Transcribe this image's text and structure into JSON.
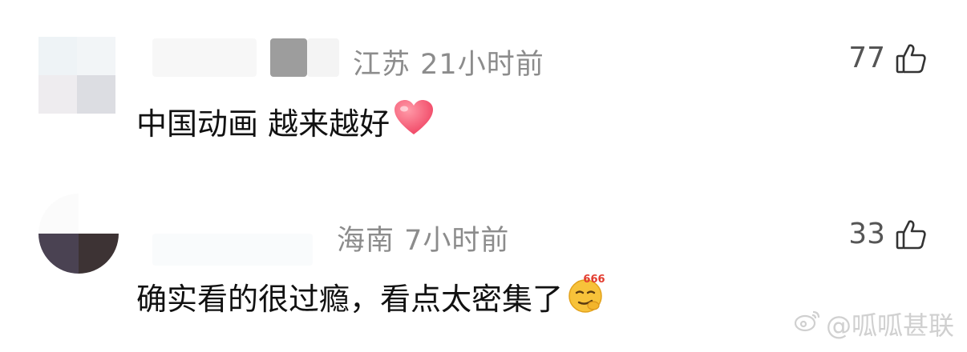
{
  "comments": [
    {
      "location": "江苏",
      "time": "21小时前",
      "text": "中国动画 越来越好",
      "emoji": "heart-emoji",
      "likes": "77"
    },
    {
      "location": "海南",
      "time": "7小时前",
      "text": "确实看的很过瘾，看点太密集了",
      "emoji": "smirk-666-emoji",
      "likes": "33"
    }
  ],
  "watermark": {
    "text": "@呱呱甚联"
  },
  "colors": {
    "meta_gray": "#8c8c8c",
    "heart_red": "#f2546e",
    "emoji_yellow": "#f7c23a"
  }
}
